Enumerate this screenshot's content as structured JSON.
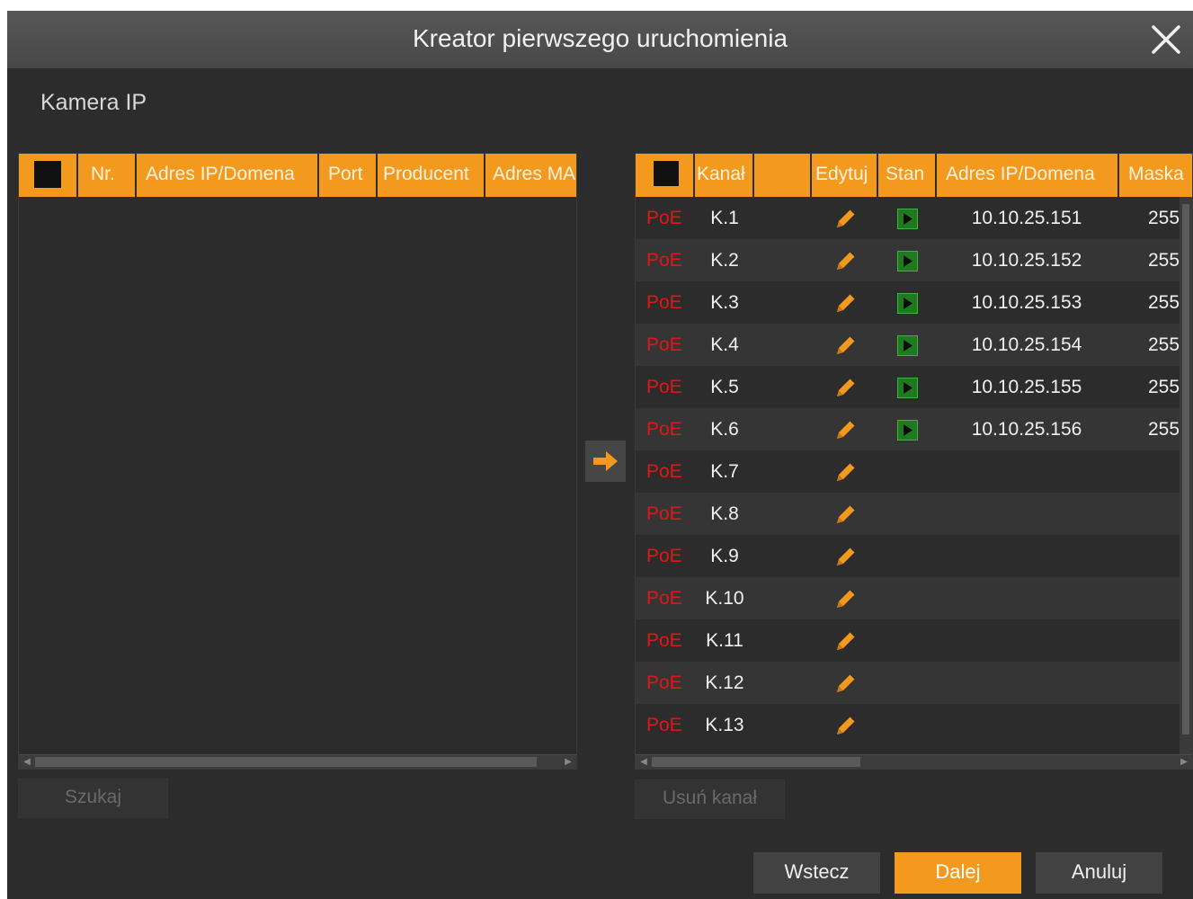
{
  "dialog": {
    "title": "Kreator pierwszego uruchomienia",
    "close_icon": "close-icon"
  },
  "section_label": "Kamera IP",
  "left_table": {
    "columns": [
      "Nr.",
      "Adres IP/Domena",
      "Port",
      "Producent",
      "Adres MA"
    ],
    "rows": [],
    "search_button": "Szukaj"
  },
  "transfer_icon": "arrow-right-icon",
  "right_table": {
    "columns": [
      "Kanał",
      "",
      "Edytuj",
      "Stan",
      "Adres IP/Domena",
      "Maska"
    ],
    "rows": [
      {
        "type": "PoE",
        "channel": "K.1",
        "ip": "10.10.25.151",
        "mask": "255",
        "status": true
      },
      {
        "type": "PoE",
        "channel": "K.2",
        "ip": "10.10.25.152",
        "mask": "255",
        "status": true
      },
      {
        "type": "PoE",
        "channel": "K.3",
        "ip": "10.10.25.153",
        "mask": "255",
        "status": true
      },
      {
        "type": "PoE",
        "channel": "K.4",
        "ip": "10.10.25.154",
        "mask": "255",
        "status": true
      },
      {
        "type": "PoE",
        "channel": "K.5",
        "ip": "10.10.25.155",
        "mask": "255",
        "status": true
      },
      {
        "type": "PoE",
        "channel": "K.6",
        "ip": "10.10.25.156",
        "mask": "255",
        "status": true
      },
      {
        "type": "PoE",
        "channel": "K.7",
        "ip": "",
        "mask": "",
        "status": false
      },
      {
        "type": "PoE",
        "channel": "K.8",
        "ip": "",
        "mask": "",
        "status": false
      },
      {
        "type": "PoE",
        "channel": "K.9",
        "ip": "",
        "mask": "",
        "status": false
      },
      {
        "type": "PoE",
        "channel": "K.10",
        "ip": "",
        "mask": "",
        "status": false
      },
      {
        "type": "PoE",
        "channel": "K.11",
        "ip": "",
        "mask": "",
        "status": false
      },
      {
        "type": "PoE",
        "channel": "K.12",
        "ip": "",
        "mask": "",
        "status": false
      },
      {
        "type": "PoE",
        "channel": "K.13",
        "ip": "",
        "mask": "",
        "status": false
      }
    ],
    "remove_button": "Usuń kanał"
  },
  "footer": {
    "back": "Wstecz",
    "next": "Dalej",
    "cancel": "Anuluj"
  },
  "colors": {
    "accent": "#f39a1e",
    "poe": "#e11616",
    "status_ok": "#1f7a1f",
    "background": "#2c2c2c"
  }
}
